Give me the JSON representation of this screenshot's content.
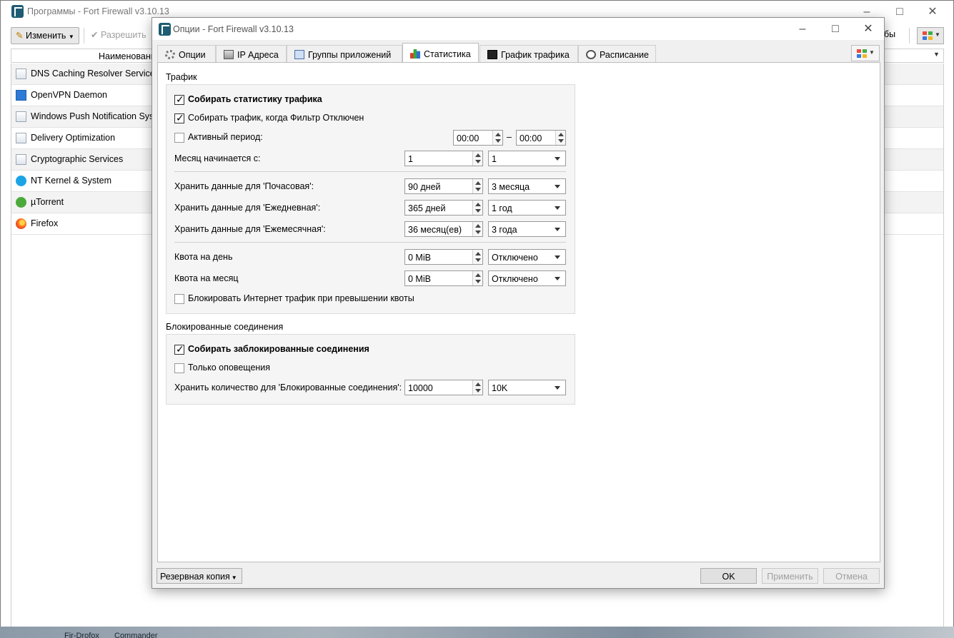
{
  "main_window": {
    "title": "Программы - Fort Firewall v3.10.13",
    "toolbar": {
      "edit_label": "Изменить",
      "allow_label": "Разрешить",
      "right_text": "бы"
    },
    "column_header": "Наименовани",
    "rows": [
      {
        "label": "DNS Caching Resolver Service",
        "icon": "service-icon"
      },
      {
        "label": "OpenVPN Daemon",
        "icon": "openvpn-icon"
      },
      {
        "label": "Windows Push Notification Syst",
        "icon": "service-icon"
      },
      {
        "label": "Delivery Optimization",
        "icon": "service-icon"
      },
      {
        "label": "Cryptographic Services",
        "icon": "service-icon"
      },
      {
        "label": "NT Kernel & System",
        "icon": "windows-icon"
      },
      {
        "label": "µTorrent",
        "icon": "utorrent-icon"
      },
      {
        "label": "Firefox",
        "icon": "firefox-icon"
      }
    ]
  },
  "dialog": {
    "title": "Опции - Fort Firewall v3.10.13",
    "tabs": [
      {
        "label": "Опции",
        "icon": "gear-icon"
      },
      {
        "label": "IP Адреса",
        "icon": "network-icon"
      },
      {
        "label": "Группы приложений",
        "icon": "groups-icon"
      },
      {
        "label": "Статистика",
        "icon": "chart-icon",
        "active": true
      },
      {
        "label": "График трафика",
        "icon": "graph-icon"
      },
      {
        "label": "Расписание",
        "icon": "clock-icon"
      }
    ],
    "traffic": {
      "group_title": "Трафик",
      "collect_stats": {
        "label": "Собирать статистику трафика",
        "checked": true
      },
      "collect_when_off": {
        "label": "Собирать трафик, когда Фильтр Отключен",
        "checked": true
      },
      "active_period": {
        "label": "Активный период:",
        "checked": false,
        "from": "00:00",
        "dash": "–",
        "to": "00:00"
      },
      "month_start": {
        "label": "Месяц начинается с:",
        "value": "1",
        "combo": "1"
      },
      "keep_hourly": {
        "label": "Хранить данные для 'Почасовая':",
        "value": "90 дней",
        "combo": "3 месяца"
      },
      "keep_daily": {
        "label": "Хранить данные для 'Ежедневная':",
        "value": "365 дней",
        "combo": "1 год"
      },
      "keep_monthly": {
        "label": "Хранить данные для 'Ежемесячная':",
        "value": "36 месяц(ев)",
        "combo": "3 года"
      },
      "quota_day": {
        "label": "Квота на день",
        "value": "0 MiB",
        "combo": "Отключено"
      },
      "quota_month": {
        "label": "Квота на месяц",
        "value": "0 MiB",
        "combo": "Отключено"
      },
      "block_on_quota": {
        "label": "Блокировать Интернет трафик при превышении квоты",
        "checked": false
      }
    },
    "blocked": {
      "group_title": "Блокированные соединения",
      "collect_blocked": {
        "label": "Собирать заблокированные соединения",
        "checked": true
      },
      "alerts_only": {
        "label": "Только оповещения",
        "checked": false
      },
      "keep_count": {
        "label": "Хранить количество для 'Блокированные соединения':",
        "value": "10000",
        "combo": "10K"
      }
    },
    "footer": {
      "backup_label": "Резервная копия",
      "ok_label": "OK",
      "apply_label": "Применить",
      "cancel_label": "Отмена"
    }
  },
  "desktop": {
    "taskbar_items": [
      "Fir-Drofox",
      "Commander"
    ]
  }
}
